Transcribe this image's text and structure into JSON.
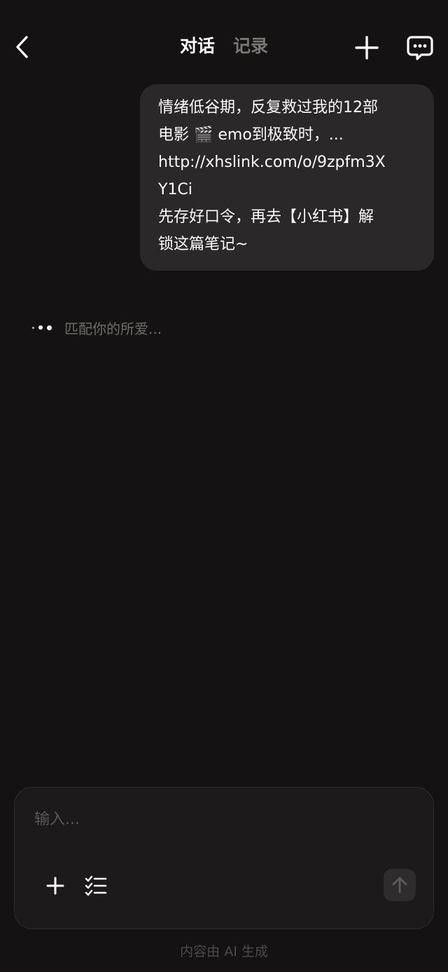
{
  "header": {
    "tabs": [
      {
        "label": "对话",
        "active": true
      },
      {
        "label": "记录",
        "active": false
      }
    ],
    "icons": {
      "back": "chevron-left-icon",
      "new": "plus-icon",
      "chat": "chat-bubble-icon"
    }
  },
  "message": {
    "lines": [
      "情绪低谷期，反复救过我的12部",
      "电影 🎬 emo到极致时，...",
      "http://xhslink.com/o/9zpfm3X",
      "Y1Ci",
      "先存好口令，再去【小红书】解",
      "锁这篇笔记~"
    ]
  },
  "status": {
    "typing_text": "匹配你的所爱..."
  },
  "composer": {
    "placeholder": "输入...",
    "icons": {
      "attach": "plus-icon",
      "tasks": "checklist-icon",
      "send": "arrow-up-icon"
    }
  },
  "footer": {
    "note": "内容由 AI 生成"
  },
  "colors": {
    "background": "#141212",
    "bubble": "#2a2828",
    "composer": "#1c1a1a",
    "muted_text": "#7b7777"
  }
}
